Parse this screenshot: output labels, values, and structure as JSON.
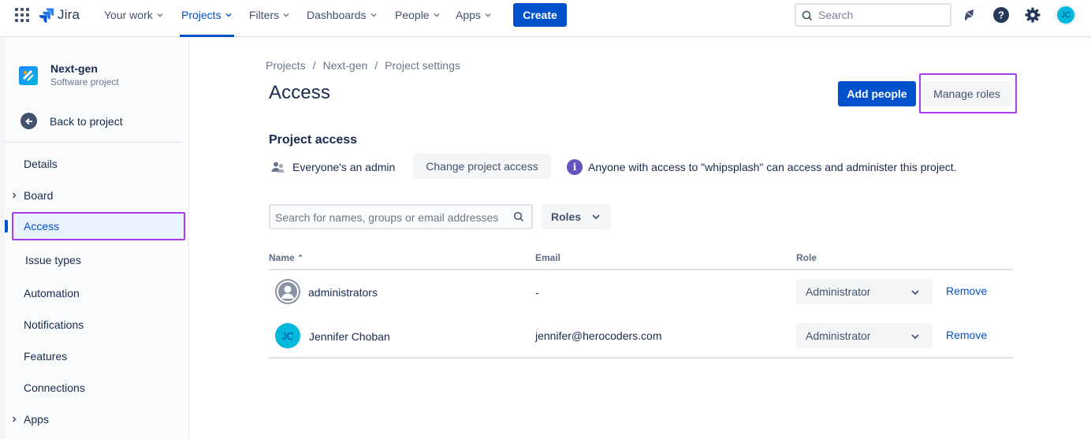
{
  "nav": {
    "logo_text": "Jira",
    "items": [
      {
        "label": "Your work"
      },
      {
        "label": "Projects"
      },
      {
        "label": "Filters"
      },
      {
        "label": "Dashboards"
      },
      {
        "label": "People"
      },
      {
        "label": "Apps"
      }
    ],
    "create_label": "Create",
    "search_placeholder": "Search",
    "user_initials": "JC"
  },
  "sidebar": {
    "project_name": "Next-gen",
    "project_type": "Software project",
    "back_label": "Back to project",
    "items": [
      {
        "label": "Details"
      },
      {
        "label": "Board",
        "expandable": true
      },
      {
        "label": "Access",
        "active": true
      },
      {
        "label": "Issue types"
      },
      {
        "label": "Automation"
      },
      {
        "label": "Notifications"
      },
      {
        "label": "Features"
      },
      {
        "label": "Connections"
      },
      {
        "label": "Apps",
        "expandable": true
      }
    ]
  },
  "breadcrumb": [
    "Projects",
    "Next-gen",
    "Project settings"
  ],
  "page": {
    "title": "Access",
    "add_people_label": "Add people",
    "manage_roles_label": "Manage roles",
    "section_title": "Project access",
    "access_level": "Everyone's an admin",
    "change_access_label": "Change project access",
    "info_text": "Anyone with access to \"whipsplash\" can access and administer this project.",
    "filter_placeholder": "Search for names, groups or email addresses",
    "roles_filter_label": "Roles"
  },
  "table": {
    "headers": {
      "name": "Name",
      "email": "Email",
      "role": "Role"
    },
    "rows": [
      {
        "name": "administrators",
        "email": "-",
        "role": "Administrator",
        "action": "Remove",
        "type": "group"
      },
      {
        "name": "Jennifer Choban",
        "email": "jennifer@herocoders.com",
        "role": "Administrator",
        "action": "Remove",
        "type": "user",
        "initials": "JC"
      }
    ]
  },
  "colors": {
    "primary": "#0052cc",
    "highlight": "#a93cf0",
    "info": "#6554c0",
    "avatar": "#00b8d9"
  }
}
